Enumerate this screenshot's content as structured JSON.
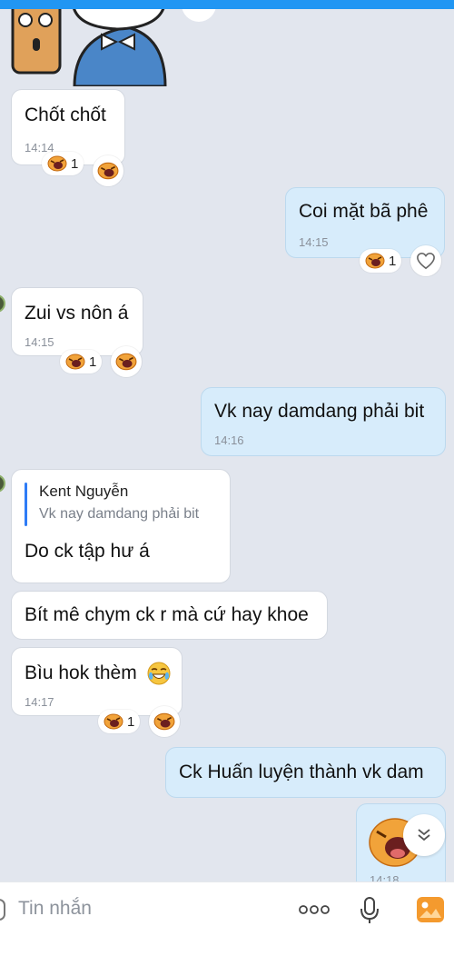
{
  "messages": [
    {
      "id": "m1",
      "text": "Chốt chốt",
      "time": "14:14",
      "reaction_count": "1"
    },
    {
      "id": "m2",
      "text": "Coi mặt bã phê",
      "time": "14:15",
      "reaction_count": "1"
    },
    {
      "id": "m3",
      "text": "Zui vs nôn á",
      "time": "14:15",
      "reaction_count": "1"
    },
    {
      "id": "m4",
      "text": "Vk nay damdang phải bit",
      "time": "14:16"
    },
    {
      "id": "m5",
      "reply_to": {
        "name": "Kent Nguyễn",
        "text": "Vk nay damdang phải bit"
      },
      "text": "Do ck tập hư á"
    },
    {
      "id": "m6",
      "text": "Bít mê chym ck r mà cứ hay khoe"
    },
    {
      "id": "m7",
      "text": "Bìu hok thèm",
      "time": "14:17",
      "reaction_count": "1"
    },
    {
      "id": "m8",
      "text": "Ck Huấn luyện thành vk dam"
    },
    {
      "id": "m9",
      "time": "14:18"
    }
  ],
  "input": {
    "placeholder": "Tin nhắn"
  },
  "icons": {
    "laugh": "laughing-emoji-icon",
    "tear": "tears-of-joy-emoji-icon",
    "heart": "heart-outline-icon",
    "more": "more-dots-icon",
    "mic": "microphone-icon",
    "gallery": "image-gallery-icon",
    "scroll": "double-chevron-down-icon"
  },
  "colors": {
    "accent": "#2196f3",
    "outgoing": "#d7ecfb",
    "incoming": "#ffffff",
    "background": "#e2e6ee"
  }
}
